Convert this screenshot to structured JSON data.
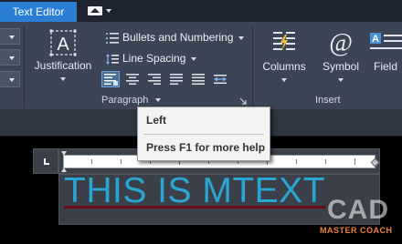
{
  "tabs": {
    "active": "Text Editor"
  },
  "formatting": {
    "justification_label": "Justification",
    "bullets_label": "Bullets and Numbering",
    "line_spacing_label": "Line Spacing",
    "paragraph_panel_title": "Paragraph",
    "align_buttons": [
      "align-left",
      "align-center",
      "align-right",
      "justify",
      "distribute"
    ]
  },
  "insert": {
    "columns_label": "Columns",
    "symbol_label": "Symbol",
    "field_label": "Field",
    "panel_title": "Insert"
  },
  "tooltip": {
    "title": "Left",
    "help": "Press F1 for more help"
  },
  "editor": {
    "text": "THIS IS MTEXT"
  },
  "watermark": {
    "top": "CAD",
    "bottom": "MASTER COACH"
  },
  "colors": {
    "accent": "#2a7fd4",
    "ribbon": "#3b4555",
    "mtext": "#2aa6d2",
    "watermark_orange": "#f08030"
  }
}
